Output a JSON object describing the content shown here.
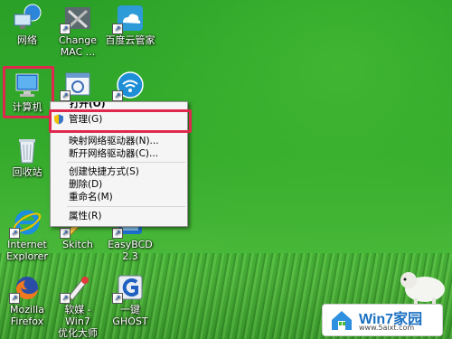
{
  "desktop": {
    "icons": {
      "network": "网络",
      "change_mac": "Change\nMAC ...",
      "baidu": "百度云管家",
      "computer": "计算机",
      "recycle": "回收站",
      "ie": "Internet\nExplorer",
      "skitch": "Skitch",
      "easybcd": "EasyBCD\n2.3",
      "firefox": "Mozilla\nFirefox",
      "youhua": "软媒 - Win7\n优化大师",
      "ghost": "一键GHOST"
    }
  },
  "context_menu": {
    "open_partial": "打开(O)",
    "items": [
      "管理(G)",
      "映射网络驱动器(N)...",
      "断开网络驱动器(C)...",
      "创建快捷方式(S)",
      "删除(D)",
      "重命名(M)",
      "属性(R)"
    ]
  },
  "watermark": {
    "title": "Win7家园",
    "url": "www.5aixt.com"
  },
  "colors": {
    "highlight_border": "#e0284f",
    "desktop_green": "#35ab2c"
  }
}
